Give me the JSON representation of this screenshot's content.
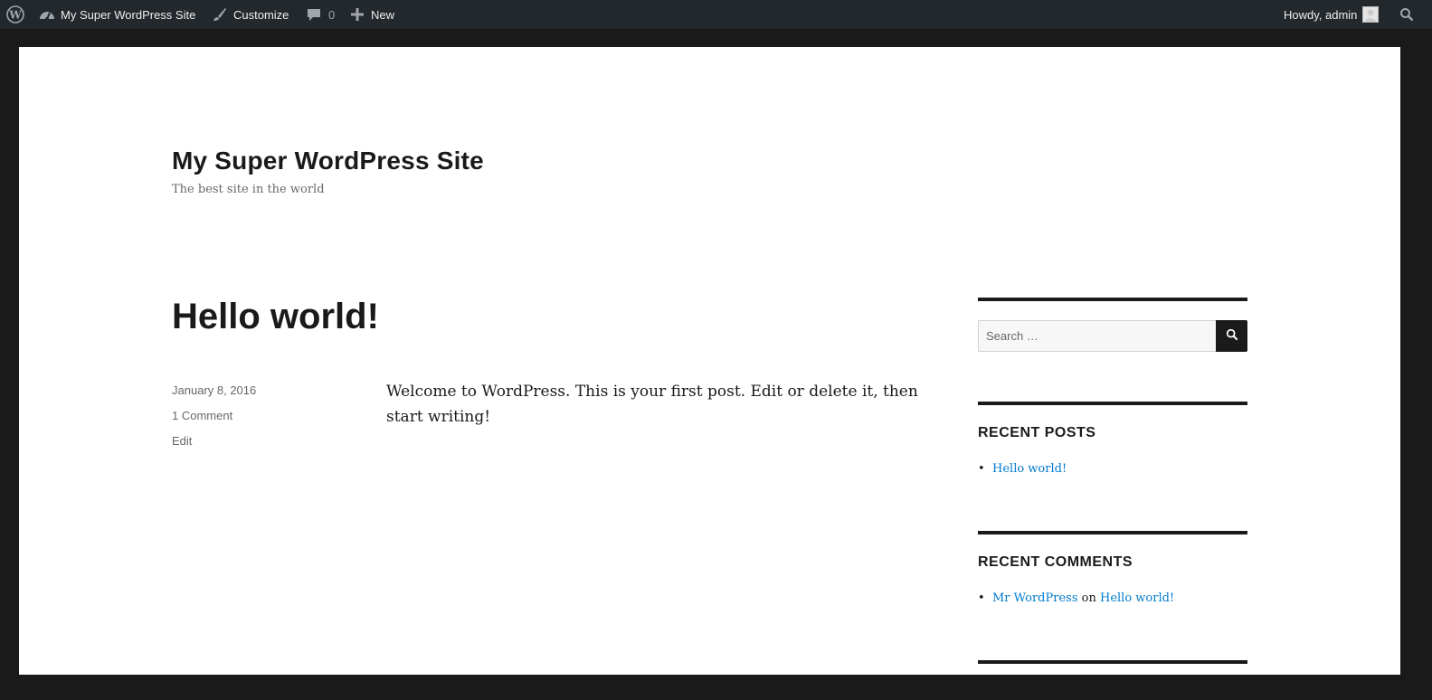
{
  "admin_bar": {
    "site_name": "My Super WordPress Site",
    "customize_label": "Customize",
    "comments_count": "0",
    "new_label": "New",
    "greeting": "Howdy, admin"
  },
  "site": {
    "title": "My Super WordPress Site",
    "description": "The best site in the world"
  },
  "post": {
    "title": "Hello world!",
    "date": "January 8, 2016",
    "comments_link": "1 Comment",
    "edit_link": "Edit",
    "content": "Welcome to WordPress. This is your first post. Edit or delete it, then start writing!"
  },
  "sidebar": {
    "search_placeholder": "Search …",
    "recent_posts": {
      "title": "RECENT POSTS",
      "items": [
        "Hello world!"
      ]
    },
    "recent_comments": {
      "title": "RECENT COMMENTS",
      "author": "Mr WordPress",
      "connector": "on",
      "post": "Hello world!"
    }
  },
  "colors": {
    "admin_bar_bg": "#23282d",
    "link": "#007acc",
    "text": "#1a1a1a",
    "meta": "#686868"
  }
}
